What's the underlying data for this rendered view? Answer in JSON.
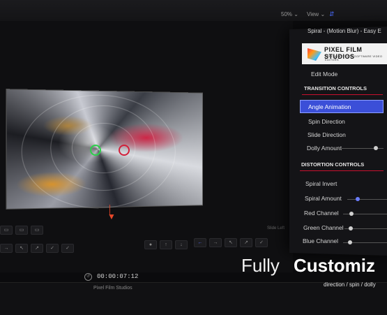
{
  "toolbar": {
    "zoom": "50%",
    "zoom_chevron": "⌄",
    "view": "View",
    "view_chevron": "⌄"
  },
  "viewer": {
    "timecode": "00:00:07:12",
    "track_label": "Pixel Film Studios",
    "step_label": "Slide Left"
  },
  "panel": {
    "title": "Spiral - (Motion Blur) - Easy E",
    "logo_text": "PIXEL FILM STUDIOS",
    "logo_sub": "SPECIAL EFFECTS SOFTWARE VIDEO EDITORS",
    "edit_mode": "Edit Mode",
    "transition_header": "TRANSITION CONTROLS",
    "transition_items": [
      "Angle Animation",
      "Spin Direction",
      "Slide Direction",
      "Dolly Amount"
    ],
    "distortion_header": "DISTORTION CONTROLS",
    "distortion_items": [
      "Spiral Invert",
      "Spiral Amount",
      "Red Channel",
      "Green Channel",
      "Blue Channel"
    ]
  },
  "overlay": {
    "headline_light": "Fully",
    "headline_bold": "Customiz",
    "subline": "direction / spin / dolly"
  },
  "colors": {
    "accent_red": "#c8102e",
    "selection_blue": "#3b4fd8",
    "handle_green": "#2bd14a",
    "handle_red": "#d2203a"
  }
}
